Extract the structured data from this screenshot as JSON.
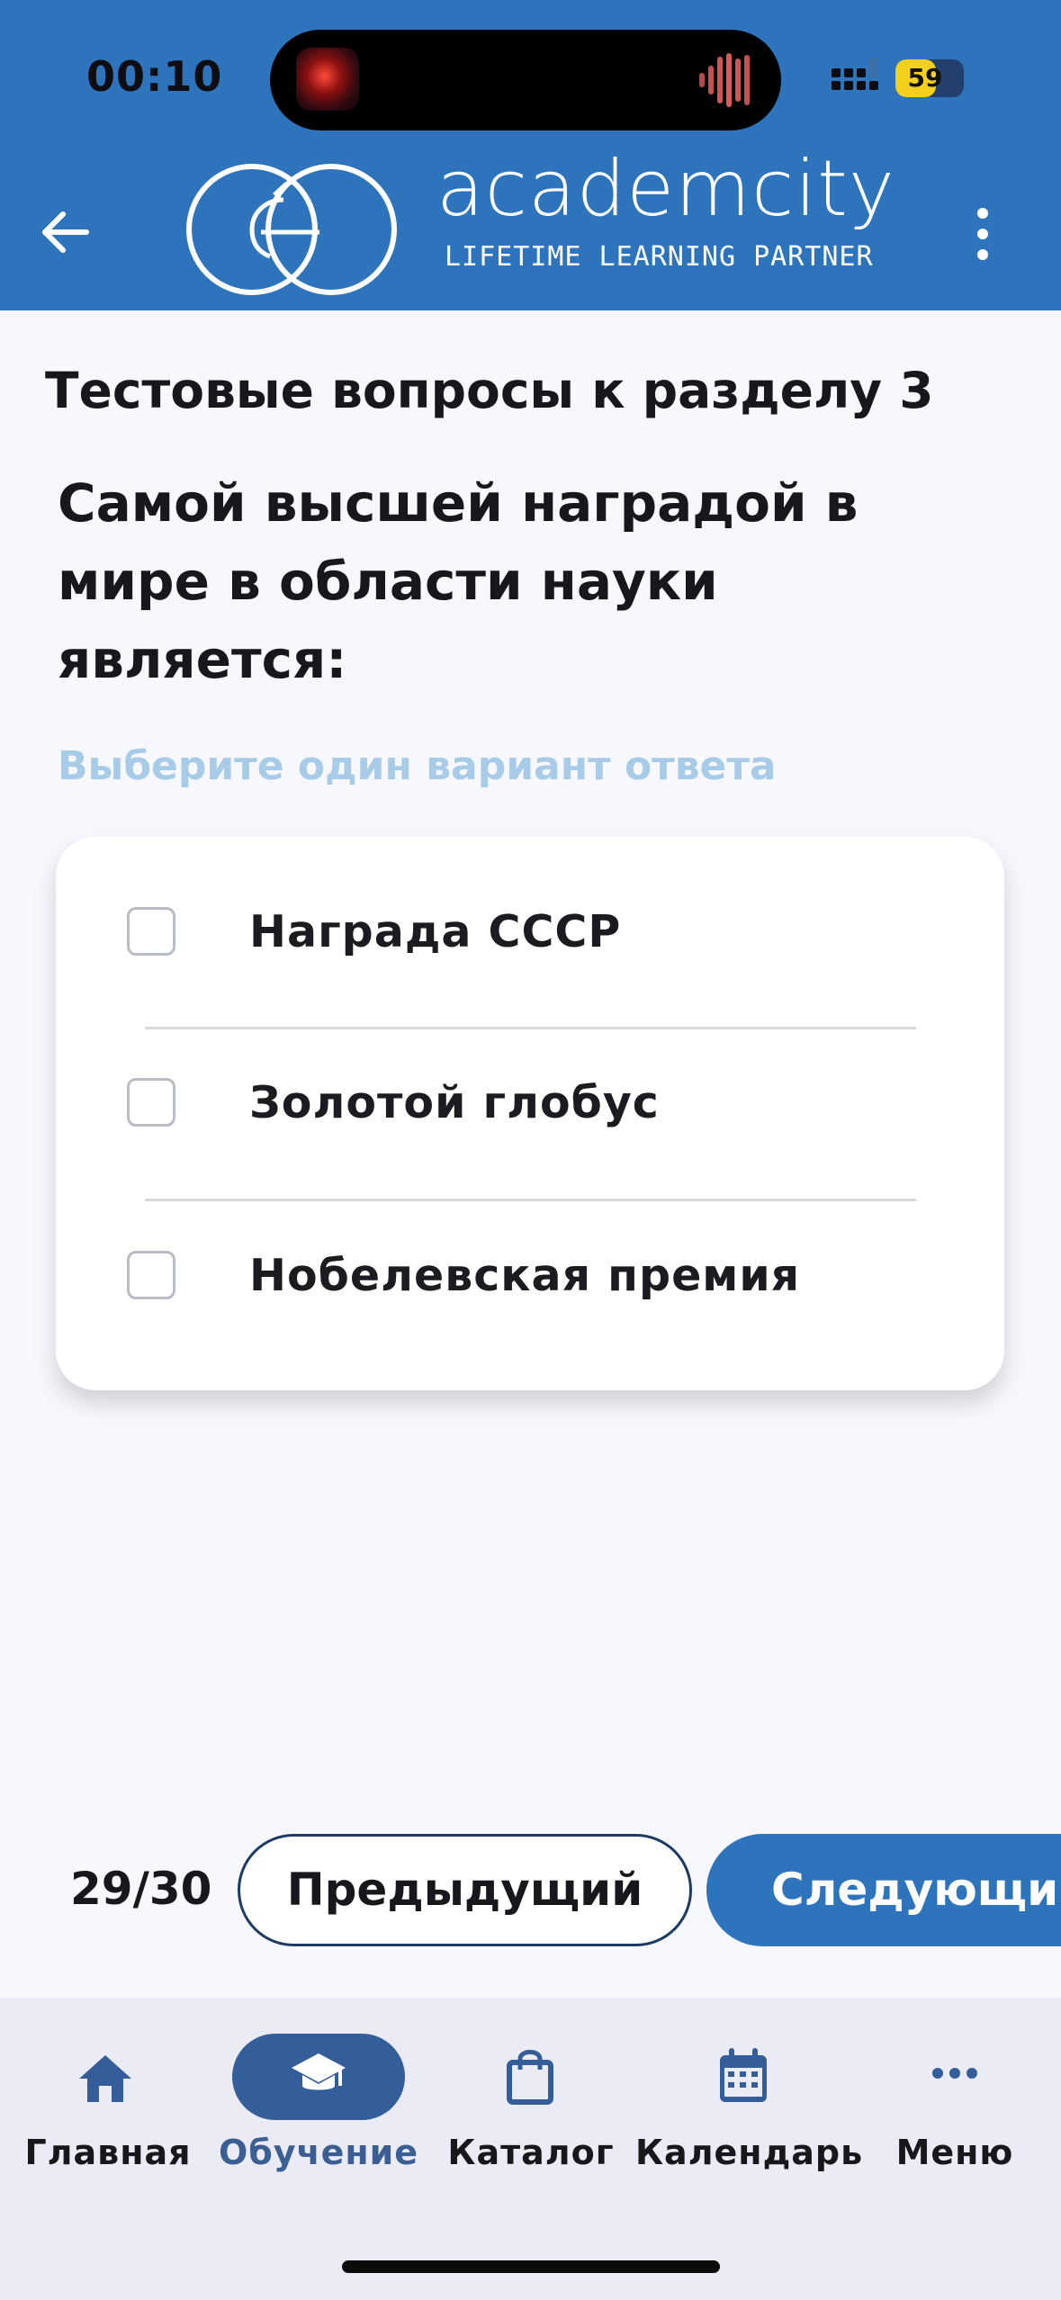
{
  "status_bar": {
    "time": "00:10",
    "battery_level": "59",
    "battery_color": "#f3cf1e"
  },
  "header": {
    "brand_name": "academcity",
    "brand_tagline": "LIFETIME LEARNING PARTNER",
    "background_color": "#2e74bd",
    "back_icon": "arrow-left-icon",
    "more_icon": "more-vertical-icon"
  },
  "content": {
    "section_title": "Тестовые вопросы к разделу 3",
    "question_lines": [
      "Самой высшей наградой в",
      "мире в области науки",
      "является:"
    ],
    "hint": "Выберите один вариант ответа",
    "options": [
      {
        "label": "Награда СССР",
        "checked": false
      },
      {
        "label": "Золотой глобус",
        "checked": false
      },
      {
        "label": "Нобелевская премия",
        "checked": false
      }
    ]
  },
  "pager": {
    "counter": "29/30",
    "prev_label": "Предыдущий",
    "next_label": "Следующий",
    "accent_color": "#2e74bd"
  },
  "bottom_nav": {
    "items": [
      {
        "label": "Главная",
        "icon": "home-icon",
        "active": false
      },
      {
        "label": "Обучение",
        "icon": "graduation-cap-icon",
        "active": true
      },
      {
        "label": "Каталог",
        "icon": "shopping-bag-icon",
        "active": false
      },
      {
        "label": "Календарь",
        "icon": "calendar-icon",
        "active": false
      },
      {
        "label": "Меню",
        "icon": "more-horizontal-icon",
        "active": false
      }
    ],
    "active_color": "#335e99"
  }
}
